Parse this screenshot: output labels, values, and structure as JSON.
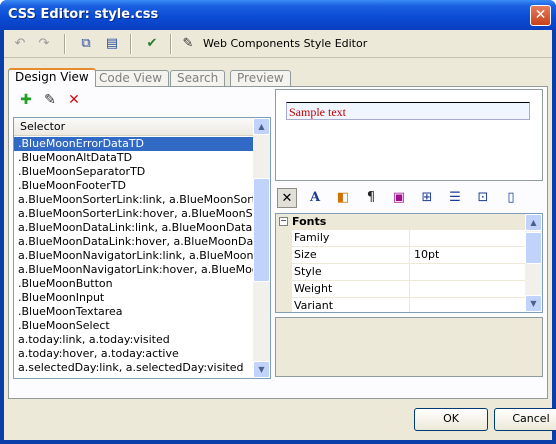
{
  "window": {
    "title": "CSS Editor: style.css",
    "close_glyph": "✕"
  },
  "toolbar": {
    "icons": [
      "undo-icon",
      "redo-icon",
      "copy-style-icon",
      "paste-style-icon",
      "validate-icon",
      "style-editor-icon"
    ],
    "style_editor_label": "Web Components Style Editor"
  },
  "tabs": [
    {
      "label": "Design View",
      "active": true
    },
    {
      "label": "Code View",
      "active": false
    },
    {
      "label": "Search",
      "active": false
    },
    {
      "label": "Preview",
      "active": false
    }
  ],
  "selector_list": {
    "tools": [
      "add-icon",
      "edit-icon",
      "delete-icon"
    ],
    "header": "Selector",
    "rows": [
      ".BlueMoonErrorDataTD",
      ".BlueMoonAltDataTD",
      ".BlueMoonSeparatorTD",
      ".BlueMoonFooterTD",
      "a.BlueMoonSorterLink:link, a.BlueMoonSorter...",
      "a.BlueMoonSorterLink:hover, a.BlueMoonSort...",
      "a.BlueMoonDataLink:link, a.BlueMoonDataLink...",
      "a.BlueMoonDataLink:hover, a.BlueMoonDataL...",
      "a.BlueMoonNavigatorLink:link, a.BlueMoonNa...",
      "a.BlueMoonNavigatorLink:hover, a.BlueMoon...",
      ".BlueMoonButton",
      ".BlueMoonInput",
      ".BlueMoonTextarea",
      ".BlueMoonSelect",
      "a.today:link, a.today:visited",
      "a.today:hover, a.today:active",
      "a.selectedDay:link, a.selectedDay:visited"
    ],
    "selected_index": 0
  },
  "preview": {
    "sample_text": "Sample text",
    "sample_color": "#c00000"
  },
  "property_tabs": [
    "clear-icon",
    "font-icon",
    "background-icon",
    "text-block-icon",
    "position-icon",
    "layout-icon",
    "list-icon",
    "edges-icon",
    "other-icon"
  ],
  "property_grid": {
    "category": "Fonts",
    "rows": [
      {
        "name": "Family",
        "value": ""
      },
      {
        "name": "Size",
        "value": "10pt"
      },
      {
        "name": "Style",
        "value": ""
      },
      {
        "name": "Weight",
        "value": ""
      },
      {
        "name": "Variant",
        "value": ""
      }
    ]
  },
  "buttons": {
    "ok": "OK",
    "cancel": "Cancel"
  },
  "colors": {
    "title_bar": "#0a4ad3",
    "selection": "#316ac5",
    "face": "#ece9d8"
  }
}
